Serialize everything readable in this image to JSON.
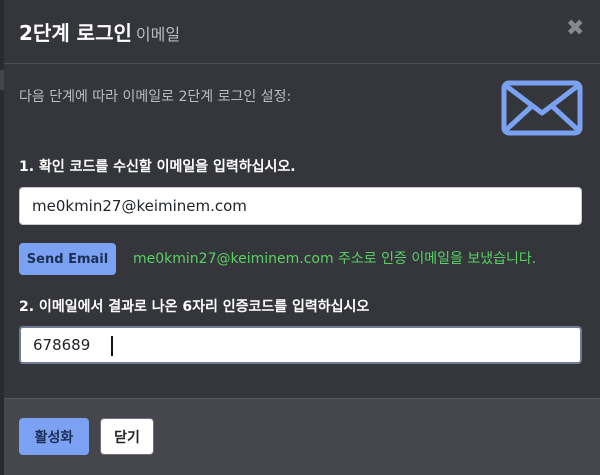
{
  "modal": {
    "title": "2단계 로그인",
    "subtitle": "이메일",
    "close_symbol": "✖",
    "intro": "다음 단계에 따라 이메일로 2단계 로그인 설정:",
    "icons": {
      "mail": "envelope-icon",
      "close": "close-icon"
    },
    "colors": {
      "accent": "#7ba2f2",
      "success_text": "#59d163",
      "panel": "#34363b"
    }
  },
  "step1": {
    "label": "1. 확인 코드를 수신할 이메일을 입력하십시오.",
    "email_value": "me0kmin27@keiminem.com",
    "send_label": "Send Email",
    "sent_message": "me0kmin27@keiminem.com 주소로 인증 이메일을 보냈습니다."
  },
  "step2": {
    "label": "2. 이메일에서 결과로 나온 6자리 인증코드를 입력하십시오",
    "code_value": "678689"
  },
  "footer": {
    "activate_label": "활성화",
    "close_label": "닫기"
  }
}
